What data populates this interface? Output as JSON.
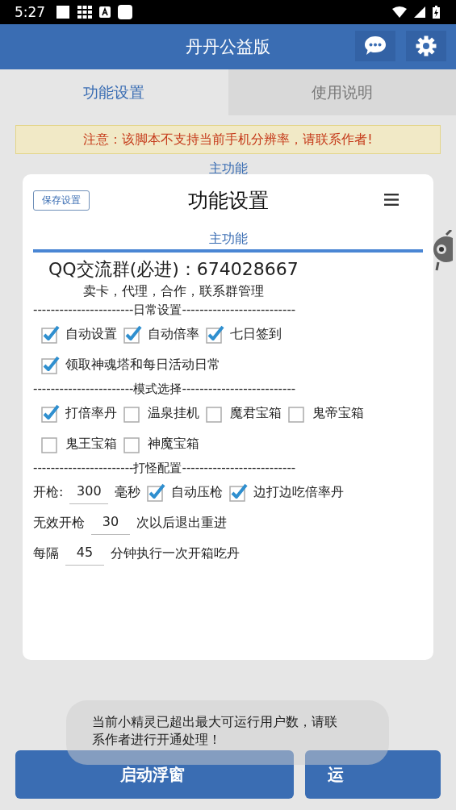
{
  "status_bar": {
    "time": "5:27"
  },
  "app_bar": {
    "title": "丹丹公益版"
  },
  "tabs": [
    {
      "label": "功能设置",
      "selected": true
    },
    {
      "label": "使用说明",
      "selected": false
    }
  ],
  "notice": "注意：该脚本不支持当前手机分辨率，请联系作者!",
  "background_section_label": "主功能",
  "bottom_buttons": [
    "启动浮窗",
    "运"
  ],
  "dialog": {
    "save_button": "保存设置",
    "title": "功能设置",
    "section_tab": "主功能",
    "group_line": "QQ交流群(必进)：674028667",
    "group_subtitle": "卖卡，代理，合作，联系群管理",
    "sections": [
      {
        "title": "-----------------------日常设置--------------------------",
        "rows": [
          [
            {
              "kind": "checkbox",
              "label": "自动设置",
              "checked": true
            },
            {
              "kind": "checkbox",
              "label": "自动倍率",
              "checked": true
            },
            {
              "kind": "checkbox",
              "label": "七日签到",
              "checked": true
            }
          ],
          [
            {
              "kind": "checkbox",
              "label": "领取神魂塔和每日活动日常",
              "checked": true
            }
          ]
        ]
      },
      {
        "title": "-----------------------模式选择--------------------------",
        "rows": [
          [
            {
              "kind": "checkbox",
              "label": "打倍率丹",
              "checked": true
            },
            {
              "kind": "checkbox",
              "label": "温泉挂机",
              "checked": false
            },
            {
              "kind": "checkbox",
              "label": "魔君宝箱",
              "checked": false
            },
            {
              "kind": "checkbox",
              "label": "鬼帝宝箱",
              "checked": false
            }
          ],
          [
            {
              "kind": "checkbox",
              "label": "鬼王宝箱",
              "checked": false
            },
            {
              "kind": "checkbox",
              "label": "神魔宝箱",
              "checked": false
            }
          ]
        ]
      },
      {
        "title": "-----------------------打怪配置--------------------------",
        "rows": [
          [
            {
              "kind": "text",
              "label": "开枪:"
            },
            {
              "kind": "input",
              "value": "300"
            },
            {
              "kind": "text",
              "label": "毫秒"
            },
            {
              "kind": "checkbox",
              "label": "自动压枪",
              "checked": true
            },
            {
              "kind": "checkbox",
              "label": "边打边吃倍率丹",
              "checked": true
            }
          ],
          [
            {
              "kind": "text",
              "label": "无效开枪"
            },
            {
              "kind": "input",
              "value": "30"
            },
            {
              "kind": "text",
              "label": "次以后退出重进"
            }
          ],
          [
            {
              "kind": "text",
              "label": "每隔"
            },
            {
              "kind": "input",
              "value": "45"
            },
            {
              "kind": "text",
              "label": "分钟执行一次开箱吃丹"
            }
          ]
        ]
      }
    ]
  },
  "toast": "当前小精灵已超出最大可运行用户数，请联系作者进行开通处理！"
}
